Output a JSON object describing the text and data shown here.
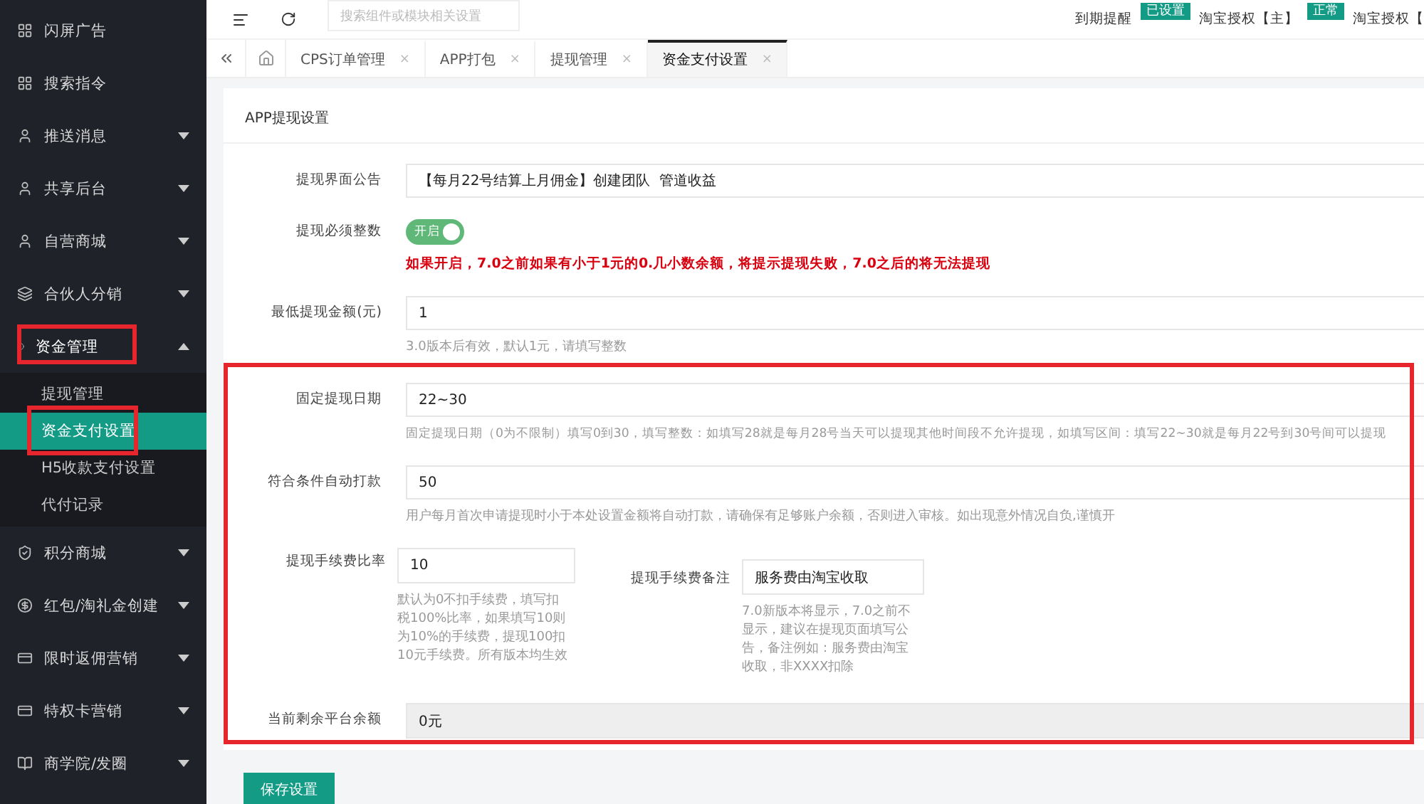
{
  "sidebar": {
    "items": [
      {
        "label": "闪屏广告",
        "expandable": false,
        "expanded": false,
        "highlighted": false
      },
      {
        "label": "搜索指令",
        "expandable": false,
        "expanded": false,
        "highlighted": false
      },
      {
        "label": "推送消息",
        "expandable": true,
        "expanded": false,
        "highlighted": false
      },
      {
        "label": "共享后台",
        "expandable": true,
        "expanded": false,
        "highlighted": false
      },
      {
        "label": "自营商城",
        "expandable": true,
        "expanded": false,
        "highlighted": false
      },
      {
        "label": "合伙人分销",
        "expandable": true,
        "expanded": false,
        "highlighted": false
      },
      {
        "label": "资金管理",
        "expandable": true,
        "expanded": true,
        "highlighted": true,
        "children": [
          {
            "label": "提现管理",
            "selected": false,
            "highlighted": false
          },
          {
            "label": "资金支付设置",
            "selected": true,
            "highlighted": true
          },
          {
            "label": "H5收款支付设置",
            "selected": false,
            "highlighted": false
          },
          {
            "label": "代付记录",
            "selected": false,
            "highlighted": false
          }
        ]
      },
      {
        "label": "积分商城",
        "expandable": true,
        "expanded": false,
        "highlighted": false
      },
      {
        "label": "红包/淘礼金创建",
        "expandable": true,
        "expanded": false,
        "highlighted": false
      },
      {
        "label": "限时返佣营销",
        "expandable": true,
        "expanded": false,
        "highlighted": false
      },
      {
        "label": "特权卡营销",
        "expandable": true,
        "expanded": false,
        "highlighted": false
      },
      {
        "label": "商学院/发圈",
        "expandable": true,
        "expanded": false,
        "highlighted": false
      }
    ]
  },
  "header": {
    "search": {
      "placeholder": "搜索组件或模块相关设置"
    },
    "status": [
      {
        "label": "到期提醒",
        "badge": "已设置"
      },
      {
        "label": "淘宝授权【主】",
        "badge": "正常"
      },
      {
        "label": "淘宝授权【"
      }
    ]
  },
  "tabs": [
    {
      "label": "CPS订单管理",
      "close": "×",
      "selected": false
    },
    {
      "label": "APP打包",
      "close": "×",
      "selected": false
    },
    {
      "label": "提现管理",
      "close": "×",
      "selected": false
    },
    {
      "label": "资金支付设置",
      "close": "×",
      "selected": true
    }
  ],
  "form": {
    "title": "APP提现设置",
    "fields": [
      {
        "kind": "text",
        "label": "提现界面公告",
        "value": "【每月22号结算上月佣金】创建团队  管道收益"
      },
      {
        "kind": "switch",
        "label": "提现必须整数",
        "switch_text": "开启",
        "on": true,
        "warning": "如果开启，7.0之前如果有小于1元的0.几小数余额，将提示提现失败，7.0之后的将无法提现"
      },
      {
        "kind": "text",
        "label": "最低提现金额(元)",
        "value": "1",
        "help": "3.0版本后有效，默认1元，请填写整数"
      }
    ],
    "highlight_group": {
      "highlighted": true,
      "fields": [
        {
          "kind": "text",
          "label": "固定提现日期",
          "value": "22~30",
          "help": "固定提现日期（0为不限制）填写0到30，填写整数：如填写28就是每月28号当天可以提现其他时间段不允许提现，如填写区间：填写22~30就是每月22号到30号间可以提现"
        },
        {
          "kind": "text",
          "label": "符合条件自动打款",
          "value": "50",
          "help": "用户每月首次申请提现时小于本处设置金额将自动打款，请确保有足够账户余额，否则进入审核。如出现意外情况自负,谨慎开"
        },
        {
          "kind": "pair",
          "items": [
            {
              "label": "提现手续费比率",
              "value": "10",
              "help": "默认为0不扣手续费，填写扣税100%比率，如果填写10则为10%的手续费，提现100扣10元手续费。所有版本均生效"
            },
            {
              "label": "提现手续费备注",
              "value": "服务费由淘宝收取",
              "help": "7.0新版本将显示，7.0之前不显示，建议在提现页面填写公告，备注例如：服务费由淘宝收取，非XXXX扣除"
            }
          ]
        },
        {
          "kind": "readonly",
          "label": "当前剩余平台余额",
          "value": "0元"
        }
      ]
    },
    "save_button": "保存设置"
  }
}
